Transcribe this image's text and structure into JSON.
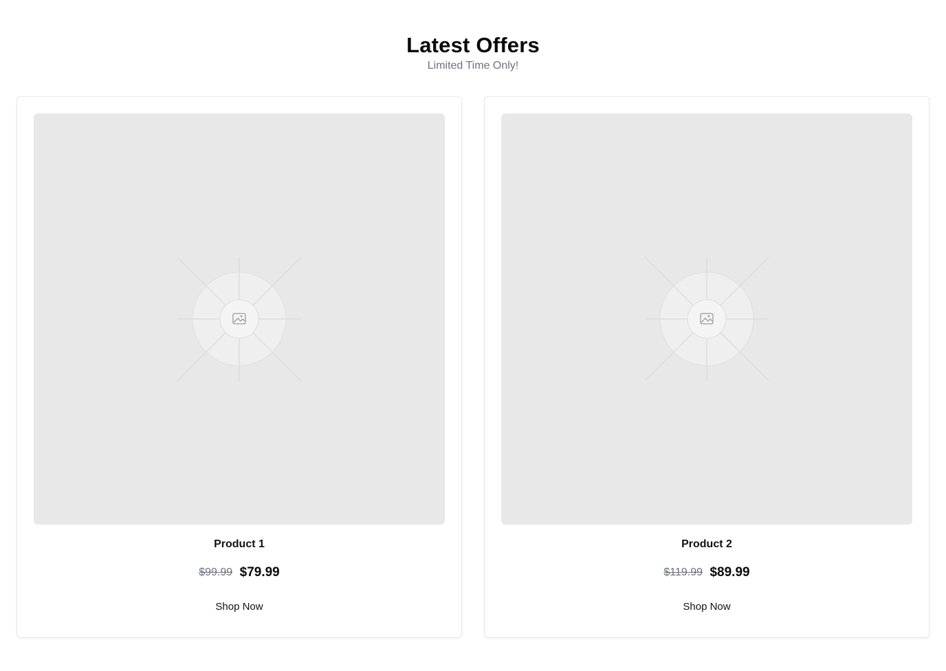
{
  "header": {
    "title": "Latest Offers",
    "subtitle": "Limited Time Only!"
  },
  "products": [
    {
      "name": "Product 1",
      "old_price": "$99.99",
      "new_price": "$79.99",
      "button_label": "Shop Now",
      "image_icon": "image-placeholder-icon"
    },
    {
      "name": "Product 2",
      "old_price": "$119.99",
      "new_price": "$89.99",
      "button_label": "Shop Now",
      "image_icon": "image-placeholder-icon"
    }
  ],
  "colors": {
    "background": "#ffffff",
    "card_border": "#e5e7eb",
    "placeholder_bg": "#e8e8e8",
    "muted_text": "#6b7280",
    "heading_text": "#0a0a0a"
  }
}
